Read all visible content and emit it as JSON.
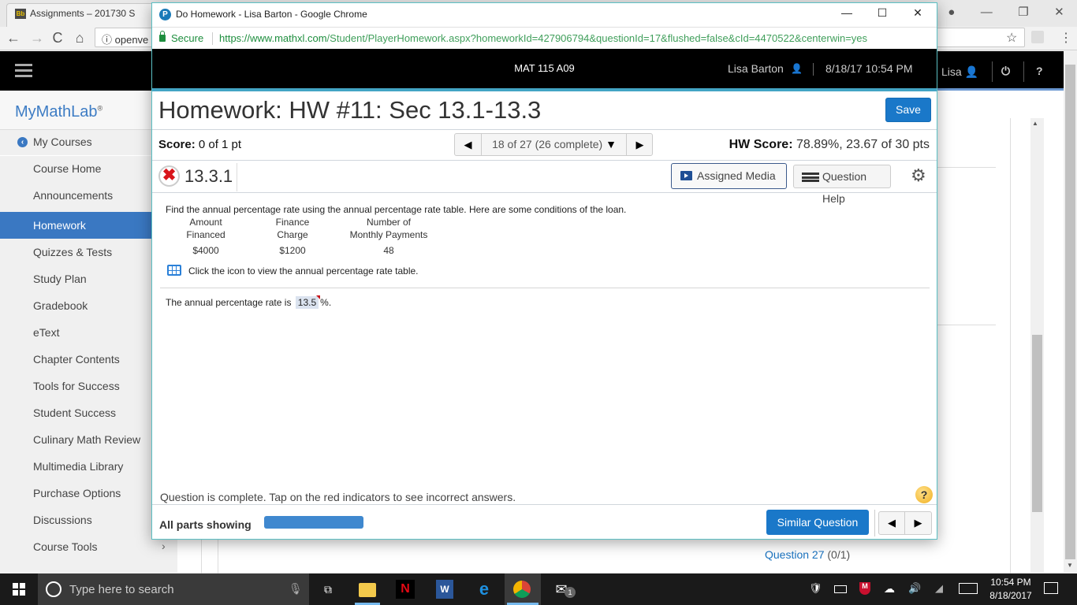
{
  "background_browser": {
    "tab_label": "Assignments – 201730 S",
    "tab_icon": "Bb",
    "address_partial": "openve",
    "nav": {
      "back": "←",
      "forward": "→",
      "reload": "C",
      "home": "⌂"
    }
  },
  "mml": {
    "logo": "MyMathLab",
    "logo_mark": "®",
    "user": "Lisa",
    "sidebar": {
      "items": [
        {
          "label": "My Courses"
        },
        {
          "label": "Course Home"
        },
        {
          "label": "Announcements"
        },
        {
          "label": "Homework",
          "active": true
        },
        {
          "label": "Quizzes & Tests"
        },
        {
          "label": "Study Plan"
        },
        {
          "label": "Gradebook"
        },
        {
          "label": "eText"
        },
        {
          "label": "Chapter Contents"
        },
        {
          "label": "Tools for Success"
        },
        {
          "label": "Student Success"
        },
        {
          "label": "Culinary Math Review"
        },
        {
          "label": "Multimedia Library"
        },
        {
          "label": "Purchase Options"
        },
        {
          "label": "Discussions"
        },
        {
          "label": "Course Tools"
        }
      ]
    },
    "question27": {
      "label": "Question 27",
      "score": "(0/1)"
    }
  },
  "popup": {
    "window_title": "Do Homework - Lisa Barton - Google Chrome",
    "secure_label": "Secure",
    "url_host": "https://www.mathxl.com",
    "url_path": "/Student/PlayerHomework.aspx?homeworkId=427906794&questionId=17&flushed=false&cId=4470522&centerwin=yes",
    "header": {
      "course": "MAT 115 A09",
      "user": "Lisa Barton",
      "datetime": "8/18/17 10:54 PM"
    },
    "title": "Homework: HW #11: Sec 13.1-13.3",
    "save_label": "Save",
    "score_label": "Score:",
    "score_value": "0 of 1 pt",
    "question_nav": "18 of 27 (26 complete)",
    "hw_score_label": "HW Score:",
    "hw_score_value": "78.89%, 23.67 of 30 pts",
    "question_number": "13.3.1",
    "assigned_media_label": "Assigned Media",
    "question_help_label": "Question Help",
    "question": {
      "prompt": "Find the annual percentage rate using the annual percentage rate table. Here are some conditions of the loan.",
      "table": {
        "headers": [
          [
            "Amount",
            "Financed"
          ],
          [
            "Finance",
            "Charge"
          ],
          [
            "Number of",
            "Monthly Payments"
          ]
        ],
        "values": [
          "$4000",
          "$1200",
          "48"
        ]
      },
      "table_hint": "Click the icon to view the annual percentage rate table.",
      "answer_prefix": "The annual percentage rate is",
      "answer_value": "13.5",
      "answer_suffix": "%.",
      "answer_correct": false
    },
    "status_message": "Question is complete. Tap on the red indicators to see incorrect answers.",
    "parts_label": "All parts showing",
    "parts_progress": 1.0,
    "similar_question_label": "Similar Question"
  },
  "taskbar": {
    "search_placeholder": "Type here to search",
    "mail_badge": "1",
    "clock_time": "10:54 PM",
    "clock_date": "8/18/2017"
  },
  "colors": {
    "accent_blue": "#1a78c9",
    "sidebar_active": "#3a78c2",
    "popup_accent": "#43a4c4",
    "incorrect_red": "#d8151b"
  }
}
